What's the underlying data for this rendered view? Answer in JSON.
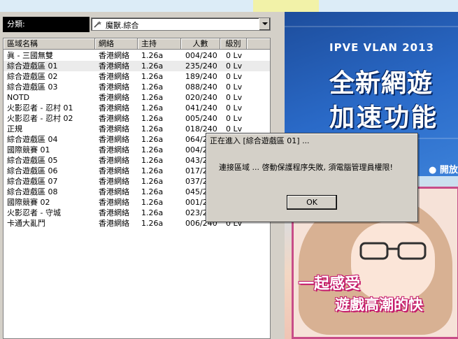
{
  "category": {
    "label": "分類:",
    "selected": "魔獸.綜合",
    "icon": "wand-icon"
  },
  "columns": [
    "區域名稱",
    "網絡",
    "主持",
    "人數",
    "級別"
  ],
  "rows": [
    {
      "name": "眞 - 三國無雙",
      "network": "香港網絡",
      "host": "1.26a",
      "players": "004/240",
      "level": "0 Lv"
    },
    {
      "name": "綜合遊戲區 01",
      "network": "香港網絡",
      "host": "1.26a",
      "players": "235/240",
      "level": "0 Lv"
    },
    {
      "name": "綜合遊戲區 02",
      "network": "香港網絡",
      "host": "1.26a",
      "players": "189/240",
      "level": "0 Lv"
    },
    {
      "name": "綜合遊戲區 03",
      "network": "香港網絡",
      "host": "1.26a",
      "players": "088/240",
      "level": "0 Lv"
    },
    {
      "name": "NOTD",
      "network": "香港網絡",
      "host": "1.26a",
      "players": "020/240",
      "level": "0 Lv"
    },
    {
      "name": "火影忍者 - 忍村 01",
      "network": "香港網絡",
      "host": "1.26a",
      "players": "041/240",
      "level": "0 Lv"
    },
    {
      "name": "火影忍者 - 忍村 02",
      "network": "香港網絡",
      "host": "1.26a",
      "players": "005/240",
      "level": "0 Lv"
    },
    {
      "name": "正規",
      "network": "香港網絡",
      "host": "1.26a",
      "players": "018/240",
      "level": "0 Lv"
    },
    {
      "name": "綜合遊戲區 04",
      "network": "香港網絡",
      "host": "1.26a",
      "players": "064/2",
      "level": ""
    },
    {
      "name": "國際競賽 01",
      "network": "香港網絡",
      "host": "1.26a",
      "players": "004/2",
      "level": ""
    },
    {
      "name": "綜合遊戲區 05",
      "network": "香港網絡",
      "host": "1.26a",
      "players": "043/2",
      "level": ""
    },
    {
      "name": "綜合遊戲區 06",
      "network": "香港網絡",
      "host": "1.26a",
      "players": "017/2",
      "level": ""
    },
    {
      "name": "綜合遊戲區 07",
      "network": "香港網絡",
      "host": "1.26a",
      "players": "037/2",
      "level": ""
    },
    {
      "name": "綜合遊戲區 08",
      "network": "香港網絡",
      "host": "1.26a",
      "players": "045/2",
      "level": ""
    },
    {
      "name": "國際競賽 02",
      "network": "香港網絡",
      "host": "1.26a",
      "players": "001/2",
      "level": ""
    },
    {
      "name": "火影忍者 - 守城",
      "network": "香港網絡",
      "host": "1.26a",
      "players": "023/2",
      "level": ""
    },
    {
      "name": "卡通大亂鬥",
      "network": "香港網絡",
      "host": "1.26a",
      "players": "006/240",
      "level": "0 Lv"
    }
  ],
  "banner": {
    "logo_text": "IPVE VLAN 2013",
    "headline_1": "全新網遊",
    "headline_2": "加速功能",
    "open_text": "● 開放",
    "sub_1": "一起感受",
    "sub_2": "遊戲高潮的快"
  },
  "dialog": {
    "title": "正在進入 [綜合遊戲區 01] ...",
    "message": "連接區域 ... 啓動保護程序失敗, 須電腦管理員權限!",
    "ok_label": "OK"
  }
}
